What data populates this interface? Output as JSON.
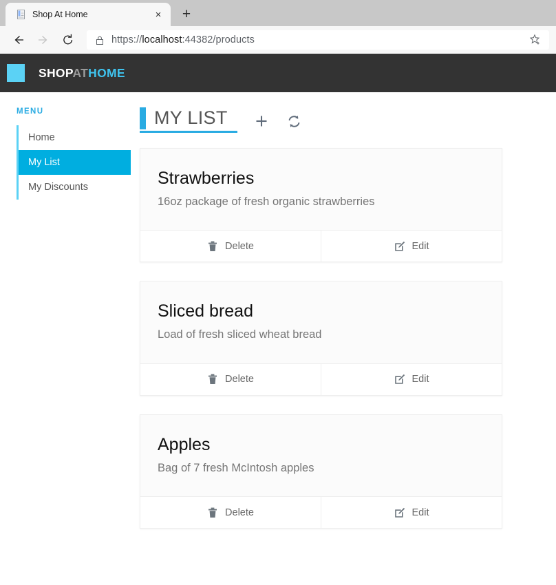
{
  "browser": {
    "tab": {
      "title": "Shop At Home",
      "favicon": "document-icon",
      "close_label": "×"
    },
    "new_tab_label": "+",
    "nav": {
      "back": "back-arrow-icon",
      "forward": "forward-arrow-icon",
      "reload": "reload-icon"
    },
    "omnibox": {
      "lock": "lock-icon",
      "url_scheme": "https://",
      "url_host": "localhost",
      "url_rest": ":44382/products",
      "full_url": "https://localhost:44382/products",
      "favorite": "star-plus-icon"
    }
  },
  "navbar": {
    "logo": "cyan-square-logo",
    "brand_part1": "SHOP",
    "brand_part2": "AT",
    "brand_part3": "HOME"
  },
  "sidebar": {
    "label": "MENU",
    "items": [
      {
        "label": "Home",
        "active": false
      },
      {
        "label": "My List",
        "active": true
      },
      {
        "label": "My Discounts",
        "active": false
      }
    ]
  },
  "main": {
    "title": "MY LIST",
    "actions": [
      {
        "name": "add-item-button",
        "icon": "plus-icon"
      },
      {
        "name": "refresh-button",
        "icon": "sync-refresh-icon"
      }
    ],
    "delete_label": "Delete",
    "edit_label": "Edit",
    "cards": [
      {
        "title": "Strawberries",
        "description": "16oz package of fresh organic strawberries"
      },
      {
        "title": "Sliced bread",
        "description": "Load of fresh sliced wheat bread"
      },
      {
        "title": "Apples",
        "description": "Bag of 7 fresh McIntosh apples"
      }
    ]
  },
  "colors": {
    "accent_cyan": "#29ABE2",
    "accent_cyan_light": "#5BD2F5",
    "active_item": "#00AEE0",
    "navbar_dark": "#333333",
    "card_body": "#fbfbfb",
    "text_muted": "#757575"
  }
}
